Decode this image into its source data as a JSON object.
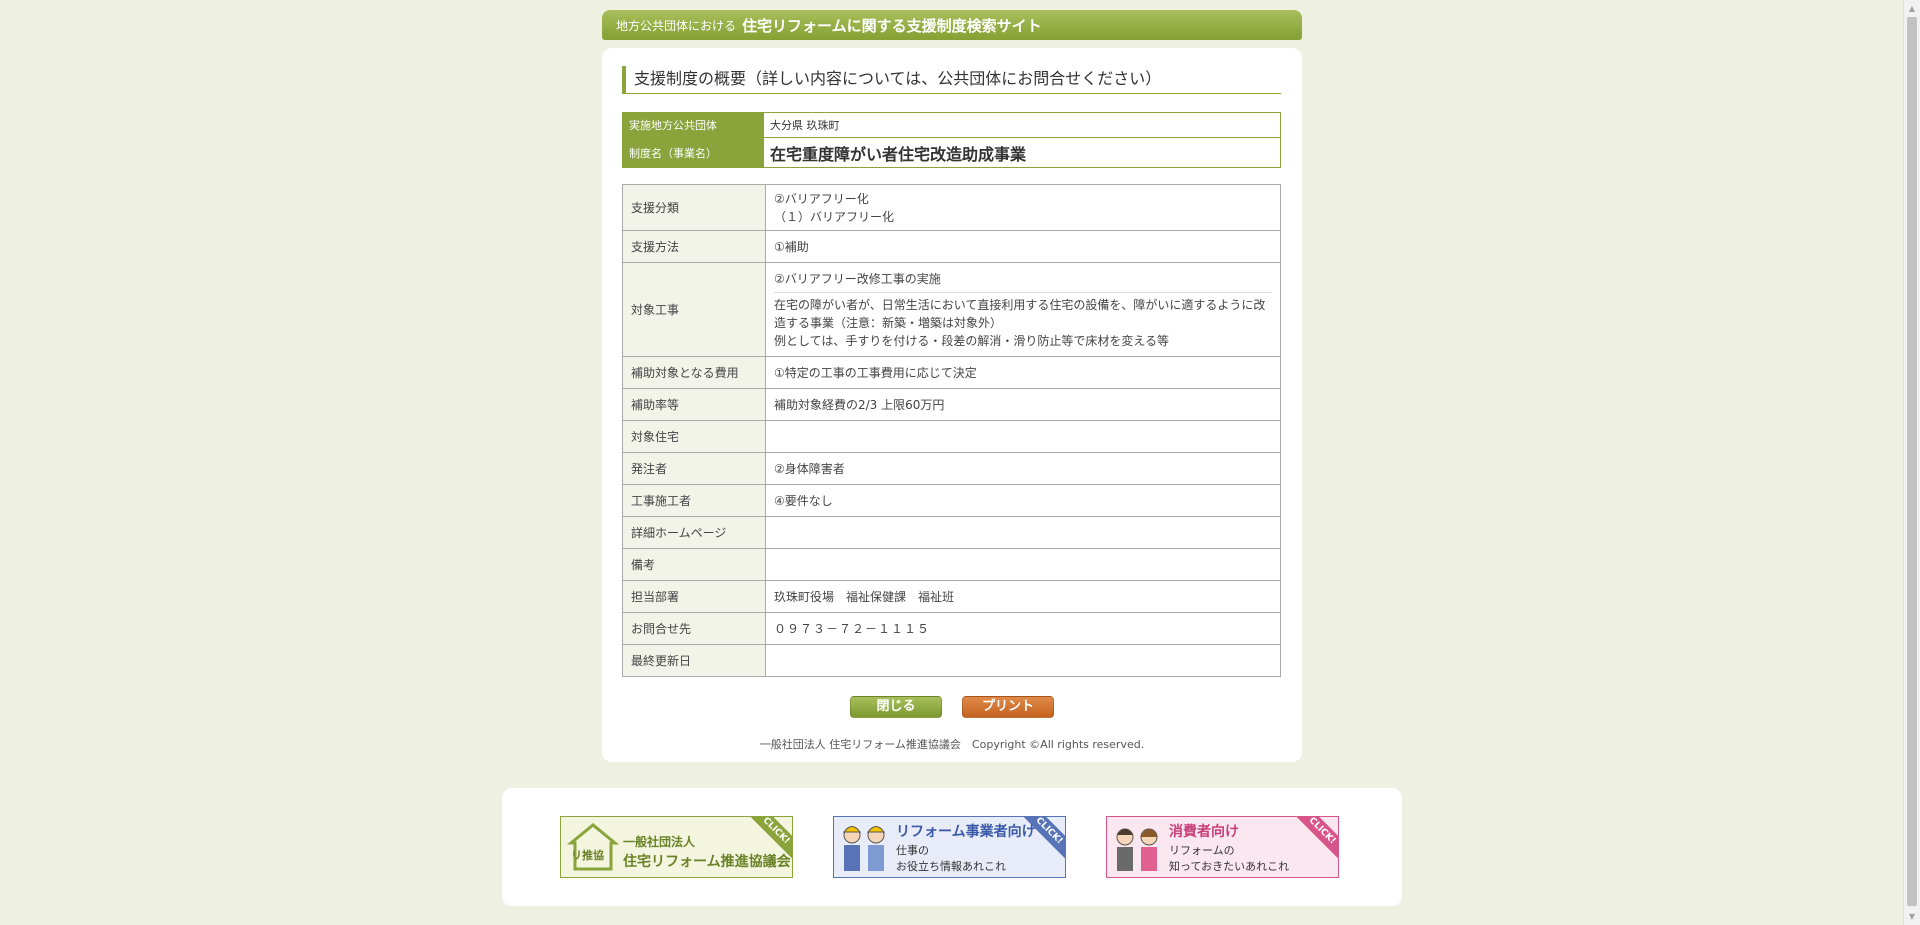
{
  "header": {
    "prefix": "地方公共団体における",
    "title": "住宅リフォームに関する支援制度検索サイト"
  },
  "section_title": "支援制度の概要（詳しい内容については、公共団体にお問合せください）",
  "summary": {
    "org_label": "実施地方公共団体",
    "org_value": "大分県 玖珠町",
    "name_label": "制度名（事業名）",
    "name_value": "在宅重度障がい者住宅改造助成事業"
  },
  "details": {
    "category_label": "支援分類",
    "category_line1": "②バリアフリー化",
    "category_line2": "（１）バリアフリー化",
    "method_label": "支援方法",
    "method_value": "①補助",
    "work_label": "対象工事",
    "work_title": "②バリアフリー改修工事の実施",
    "work_desc1": "在宅の障がい者が、日常生活において直接利用する住宅の設備を、障がいに適するように改造する事業（注意：新築・増築は対象外）",
    "work_desc2": "例としては、手すりを付ける・段差の解消・滑り防止等で床材を変える等",
    "cost_label": "補助対象となる費用",
    "cost_value": "①特定の工事の工事費用に応じて決定",
    "rate_label": "補助率等",
    "rate_value": "補助対象経費の2/3 上限60万円",
    "housing_label": "対象住宅",
    "housing_value": "",
    "orderer_label": "発注者",
    "orderer_value": "②身体障害者",
    "contractor_label": "工事施工者",
    "contractor_value": "④要件なし",
    "homepage_label": "詳細ホームページ",
    "homepage_value": "",
    "remarks_label": "備考",
    "remarks_value": "",
    "dept_label": "担当部署",
    "dept_value": "玖珠町役場　福祉保健課　福祉班",
    "contact_label": "お問合せ先",
    "contact_value": "０９７３－７２－１１１５",
    "updated_label": "最終更新日",
    "updated_value": ""
  },
  "buttons": {
    "close": "閉じる",
    "print": "プリント"
  },
  "copyright": "一般社団法人 住宅リフォーム推進協議会　Copyright ©All rights reserved.",
  "banners": [
    {
      "click": "CLICK!",
      "logo": "リ推協",
      "line1": "一般社団法人",
      "line2": "住宅リフォーム推進協議会"
    },
    {
      "click": "CLICK!",
      "line1": "リフォーム事業者向け",
      "line2": "仕事の",
      "line3": "お役立ち情報あれこれ"
    },
    {
      "click": "CLICK!",
      "line1": "消費者向け",
      "line2": "リフォームの",
      "line3": "知っておきたいあれこれ"
    }
  ],
  "colors": {
    "accent_green": "#8aa33a",
    "print_orange": "#c4621d",
    "background": "#eef1e2"
  }
}
